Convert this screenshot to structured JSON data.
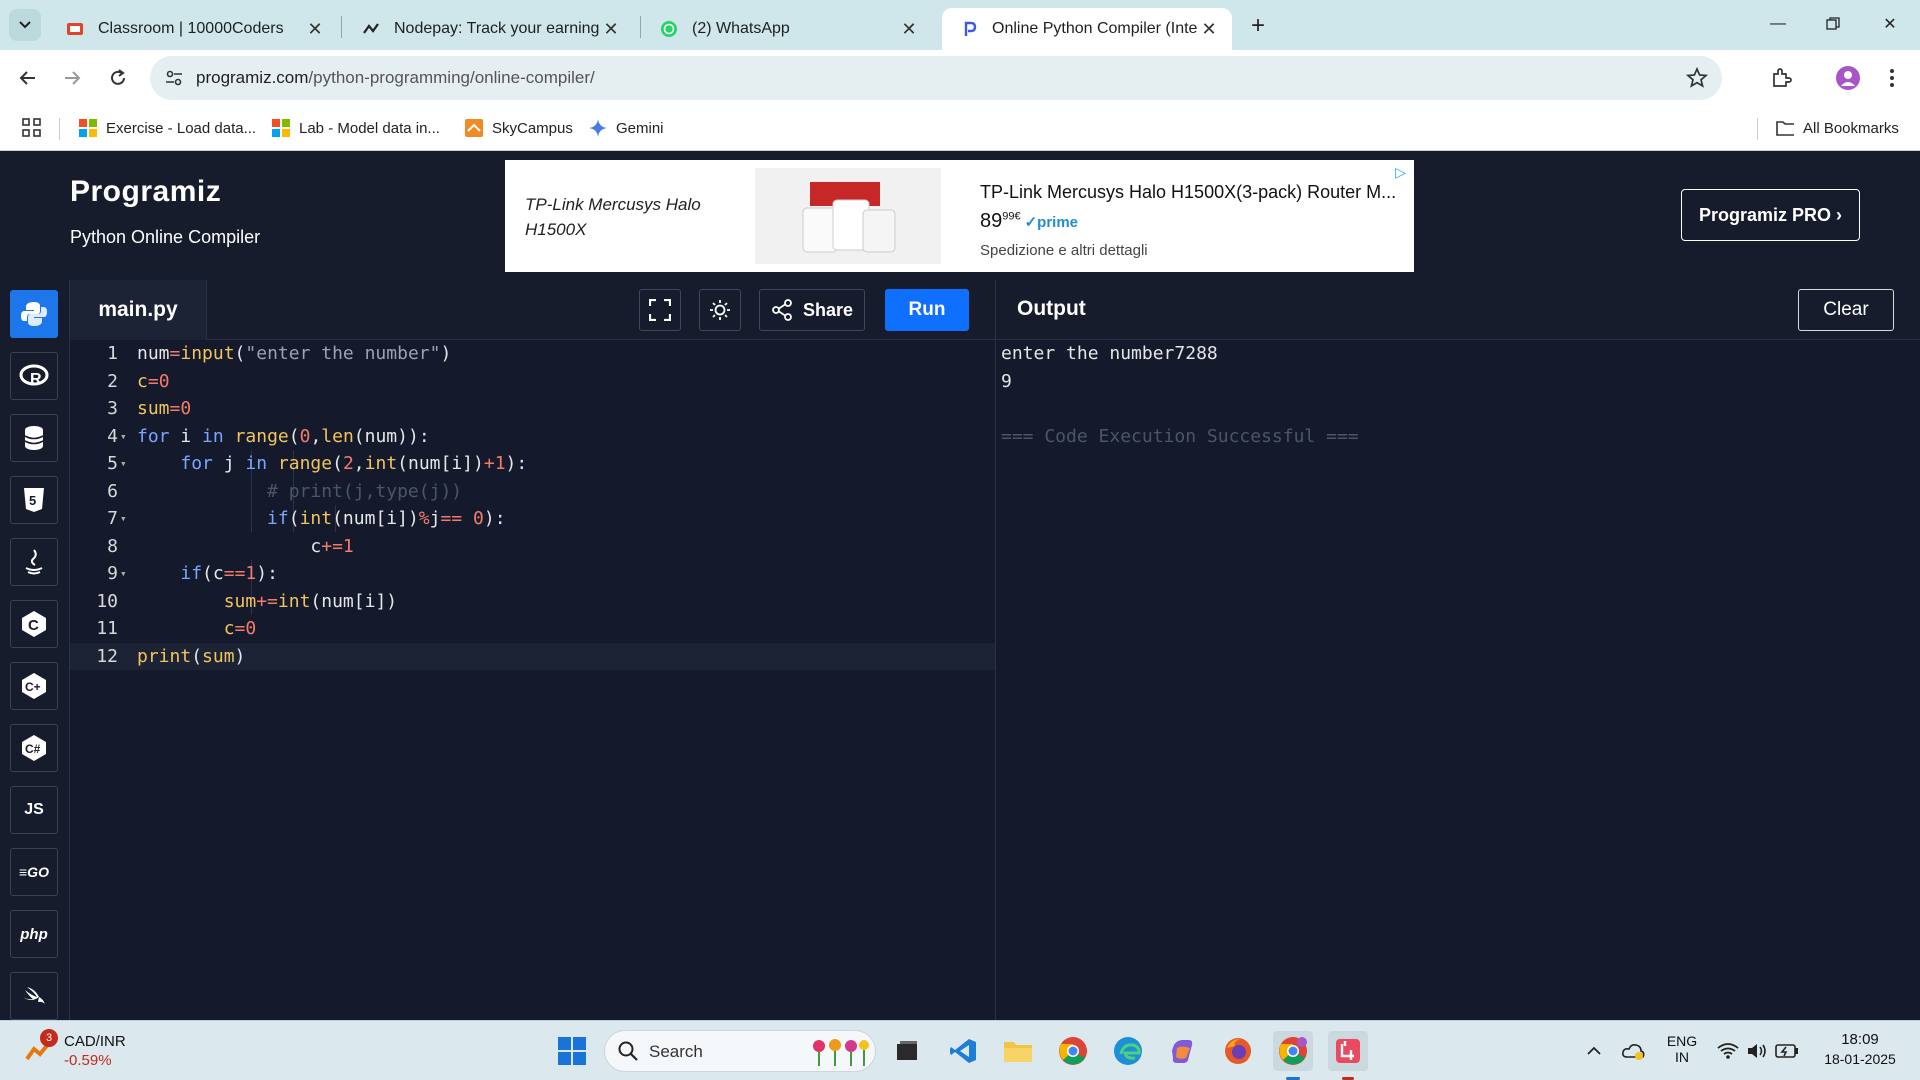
{
  "browser": {
    "tabs": [
      {
        "title": "Classroom | 10000Coders",
        "icon": "classroom-icon"
      },
      {
        "title": "Nodepay: Track your earnings",
        "icon": "nodepay-icon"
      },
      {
        "title": "(2) WhatsApp",
        "icon": "whatsapp-icon"
      },
      {
        "title": "Online Python Compiler (Interp",
        "icon": "programiz-icon",
        "active": true
      }
    ],
    "url_host": "programiz.com",
    "url_path": "/python-programming/online-compiler/",
    "bookmarks": [
      {
        "label": "Exercise - Load data...",
        "icon": "microsoft-icon"
      },
      {
        "label": "Lab - Model data in...",
        "icon": "microsoft-icon"
      },
      {
        "label": "SkyCampus",
        "icon": "skycampus-icon"
      },
      {
        "label": "Gemini",
        "icon": "gemini-icon"
      }
    ],
    "all_bookmarks": "All Bookmarks"
  },
  "site": {
    "logo": "Programiz",
    "subtitle": "Python Online Compiler",
    "pro_button": "Programiz PRO ›",
    "ad": {
      "left_text": "TP-Link Mercusys Halo H1500X",
      "title": "TP-Link Mercusys Halo H1500X(3-pack) Router M...",
      "price_main": "89",
      "price_cents": "99€",
      "prime": "✓prime",
      "shipping": "Spedizione e altri dettagli"
    }
  },
  "editor": {
    "file_name": "main.py",
    "share_label": "Share",
    "run_label": "Run",
    "line_numbers": [
      "1",
      "2",
      "3",
      "4",
      "5",
      "6",
      "7",
      "8",
      "9",
      "10",
      "11",
      "12"
    ]
  },
  "output": {
    "title": "Output",
    "clear_label": "Clear",
    "lines": [
      "enter the number7288",
      "9",
      "",
      "=== Code Execution Successful ==="
    ]
  },
  "taskbar": {
    "ticker_symbol": "CAD/INR",
    "ticker_change": "-0.59%",
    "ticker_badge": "3",
    "search_label": "Search",
    "lang_top": "ENG",
    "lang_bottom": "IN",
    "time": "18:09",
    "date": "18-01-2025"
  },
  "colors": {
    "accent": "#1e77ea",
    "run_button": "#0f6fff",
    "editor_bg": "#141a2b",
    "keyword": "#7aa6ff",
    "function": "#f2c55c",
    "number": "#f37b6a"
  }
}
